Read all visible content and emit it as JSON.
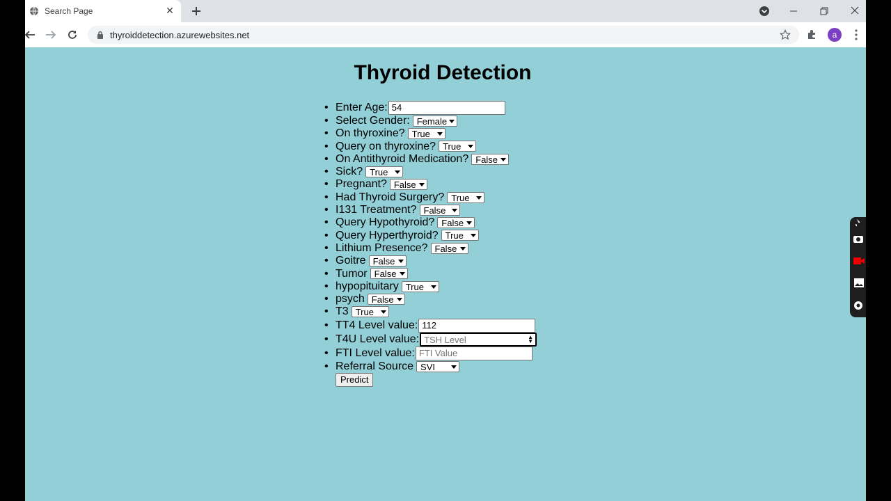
{
  "browser": {
    "tab_title": "Search Page",
    "url": "thyroiddetection.azurewebsites.net",
    "profile_initial": "a"
  },
  "page": {
    "title": "Thyroid Detection",
    "fields": [
      {
        "label": "Enter Age:",
        "kind": "input",
        "value": "54",
        "placeholder": ""
      },
      {
        "label": "Select Gender:",
        "kind": "select",
        "value": "Female"
      },
      {
        "label": "On thyroxine?",
        "kind": "select",
        "value": "True"
      },
      {
        "label": "Query on thyroxine?",
        "kind": "select",
        "value": "True"
      },
      {
        "label": "On Antithyroid Medication?",
        "kind": "select",
        "value": "False"
      },
      {
        "label": "Sick?",
        "kind": "select",
        "value": "True"
      },
      {
        "label": "Pregnant?",
        "kind": "select",
        "value": "False"
      },
      {
        "label": "Had Thyroid Surgery?",
        "kind": "select",
        "value": "True"
      },
      {
        "label": "I131 Treatment?",
        "kind": "select",
        "value": "False"
      },
      {
        "label": "Query Hypothyroid?",
        "kind": "select",
        "value": "False"
      },
      {
        "label": "Query Hyperthyroid?",
        "kind": "select",
        "value": "True"
      },
      {
        "label": "Lithium Presence?",
        "kind": "select",
        "value": "False"
      },
      {
        "label": "Goitre",
        "kind": "select",
        "value": "False"
      },
      {
        "label": "Tumor",
        "kind": "select",
        "value": "False"
      },
      {
        "label": "hypopituitary",
        "kind": "select",
        "value": "True"
      },
      {
        "label": "psych",
        "kind": "select",
        "value": "False"
      },
      {
        "label": "T3",
        "kind": "select",
        "value": "True"
      },
      {
        "label": "TT4 Level value:",
        "kind": "input",
        "value": "112",
        "placeholder": ""
      },
      {
        "label": "T4U Level value:",
        "kind": "number",
        "value": "",
        "placeholder": "TSH Level"
      },
      {
        "label": "FTI Level value:",
        "kind": "input",
        "value": "",
        "placeholder": "FTI Value"
      },
      {
        "label": "Referral Source",
        "kind": "select",
        "value": "SVI"
      }
    ],
    "submit_label": "Predict"
  }
}
